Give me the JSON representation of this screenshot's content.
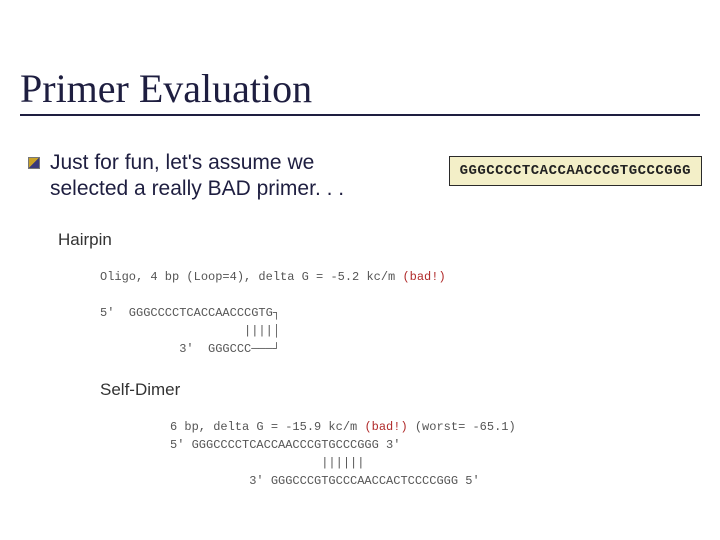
{
  "title": "Primer Evaluation",
  "bullet": "Just for fun, let's assume we selected a really BAD primer. . .",
  "primer_sequence": "GGGCCCCTCACCAACCCGTGCCCGGG",
  "sections": {
    "hairpin": {
      "label": "Hairpin",
      "line1_pre": "Oligo, 4 bp (Loop=4), delta G = -5.2 kc/m ",
      "line1_bad": "(bad!)",
      "line2": "5'  GGGCCCCTCACCAACCCGTG┐",
      "line3": "                    ||||│",
      "line4": "           3'  GGGCCC───┘"
    },
    "selfdimer": {
      "label": "Self-Dimer",
      "line1_pre": "6 bp, delta G = -15.9 kc/m ",
      "line1_bad": "(bad!)",
      "line1_post": " (worst= -65.1)",
      "line2": "5' GGGCCCCTCACCAACCCGTGCCCGGG 3'",
      "line3": "                     ||||||",
      "line4": "           3' GGGCCCGTGCCCAACCACTCCCCGGG 5'"
    }
  }
}
